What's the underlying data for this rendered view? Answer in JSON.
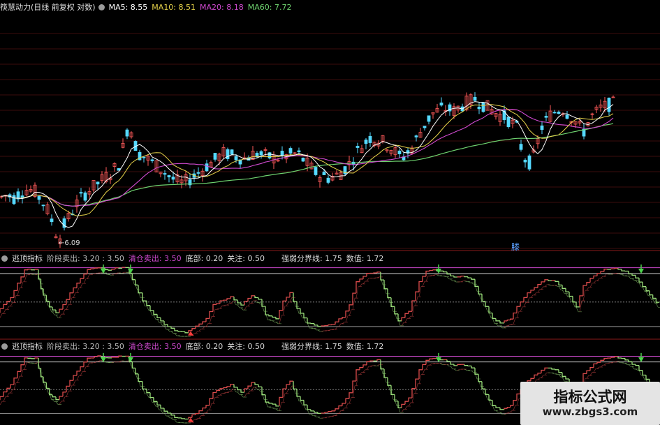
{
  "main_header": {
    "title": "筷慧动力(日线 前复权 对数)",
    "ma5": "MA5: 8.55",
    "ma10": "MA10: 8.51",
    "ma20": "MA20: 8.18",
    "ma60": "MA60: 7.72"
  },
  "ind1_header": {
    "title": "逃顶指标",
    "stage": "阶段卖出: 3.20 : 3.50",
    "clear": "清仓卖出: 3.50",
    "bottom": "底部: 0.20",
    "watch": "关注: 0.50",
    "line": "强弱分界线: 1.75",
    "value": "数值: 1.72"
  },
  "ind2_header": {
    "title": "逃顶指标",
    "stage": "阶段卖出: 3.20 : 3.50",
    "clear": "清仓卖出: 3.50",
    "bottom": "底部: 0.20",
    "watch": "关注: 0.50",
    "line": "强弱分界线: 1.75",
    "value": "数值: 1.72"
  },
  "low_label": "←6.09",
  "signal_mark": "滕",
  "watermark": {
    "title": "指标公式网",
    "url": "www.zbgs3.com"
  },
  "colors": {
    "up": "#ff5a5a",
    "down": "#55d9ff",
    "ma5": "#ffffff",
    "ma10": "#e6d24a",
    "ma20": "#d04ad0",
    "ma60": "#6fd36f",
    "ind_up": "#d94b4b",
    "ind_down": "#9be07a",
    "grid": "#7a1a1a",
    "level": "#c8c8c8"
  },
  "chart_data": [
    {
      "type": "candlestick",
      "title": "",
      "series": [
        {
          "name": "MA5"
        },
        {
          "name": "MA10"
        },
        {
          "name": "MA20"
        },
        {
          "name": "MA60"
        }
      ],
      "price_points": [
        [
          0,
          6.8
        ],
        [
          10,
          6.85
        ],
        [
          20,
          6.8
        ],
        [
          30,
          6.9
        ],
        [
          40,
          6.95
        ],
        [
          50,
          6.9
        ],
        [
          60,
          6.75
        ],
        [
          70,
          6.55
        ],
        [
          78,
          6.3
        ],
        [
          84,
          6.09
        ],
        [
          92,
          6.35
        ],
        [
          100,
          6.5
        ],
        [
          110,
          6.7
        ],
        [
          120,
          6.85
        ],
        [
          130,
          6.95
        ],
        [
          140,
          7.05
        ],
        [
          150,
          7.15
        ],
        [
          160,
          7.25
        ],
        [
          170,
          7.4
        ],
        [
          178,
          7.8
        ],
        [
          185,
          8.25
        ],
        [
          190,
          7.9
        ],
        [
          198,
          7.6
        ],
        [
          210,
          7.5
        ],
        [
          220,
          7.4
        ],
        [
          230,
          7.3
        ],
        [
          240,
          7.2
        ],
        [
          250,
          7.1
        ],
        [
          262,
          7.05
        ],
        [
          275,
          7.15
        ],
        [
          290,
          7.3
        ],
        [
          305,
          7.45
        ],
        [
          320,
          7.6
        ],
        [
          335,
          7.55
        ],
        [
          350,
          7.5
        ],
        [
          365,
          7.6
        ],
        [
          380,
          7.55
        ],
        [
          395,
          7.5
        ],
        [
          410,
          7.55
        ],
        [
          425,
          7.6
        ],
        [
          440,
          7.4
        ],
        [
          455,
          7.2
        ],
        [
          470,
          7.15
        ],
        [
          485,
          7.2
        ],
        [
          500,
          7.4
        ],
        [
          515,
          7.7
        ],
        [
          530,
          7.9
        ],
        [
          545,
          7.85
        ],
        [
          560,
          7.7
        ],
        [
          575,
          7.5
        ],
        [
          590,
          7.7
        ],
        [
          605,
          8.1
        ],
        [
          620,
          8.4
        ],
        [
          635,
          8.5
        ],
        [
          650,
          8.45
        ],
        [
          665,
          8.6
        ],
        [
          680,
          8.7
        ],
        [
          695,
          8.55
        ],
        [
          710,
          8.4
        ],
        [
          725,
          8.3
        ],
        [
          740,
          8.1
        ],
        [
          748,
          7.6
        ],
        [
          756,
          7.4
        ],
        [
          765,
          7.55
        ],
        [
          775,
          8.1
        ],
        [
          790,
          8.4
        ],
        [
          805,
          8.5
        ],
        [
          820,
          8.3
        ],
        [
          835,
          8.0
        ],
        [
          845,
          8.3
        ],
        [
          860,
          8.5
        ],
        [
          875,
          8.6
        ]
      ],
      "low_label": "6.09"
    },
    {
      "type": "step",
      "title": "",
      "levels": {
        "stage_sell": [
          3.2,
          3.5
        ],
        "clear_sell": 3.5,
        "bottom": 0.2,
        "watch": 0.5,
        "line": 1.75
      },
      "ylim": [
        0,
        3.7
      ],
      "x": [
        0,
        20,
        40,
        55,
        62,
        75,
        85,
        95,
        110,
        130,
        145,
        160,
        175,
        185,
        198,
        210,
        225,
        240,
        255,
        270,
        285,
        300,
        310,
        320,
        335,
        350,
        365,
        375,
        385,
        400,
        410,
        420,
        430,
        445,
        460,
        480,
        495,
        505,
        515,
        530,
        545,
        555,
        565,
        575,
        590,
        605,
        615,
        625,
        640,
        655,
        665,
        680,
        695,
        710,
        722,
        735,
        745,
        760,
        770,
        785,
        800,
        815,
        830,
        840,
        855,
        870,
        885,
        900,
        915,
        930,
        944
      ],
      "values": [
        1.2,
        2.0,
        3.4,
        3.4,
        2.4,
        1.5,
        1.2,
        1.6,
        2.5,
        3.4,
        3.5,
        3.4,
        3.5,
        3.5,
        2.6,
        1.8,
        1.1,
        0.6,
        0.3,
        0.2,
        0.5,
        0.9,
        1.6,
        1.8,
        2.0,
        1.6,
        2.1,
        1.9,
        1.1,
        0.9,
        1.8,
        2.2,
        1.4,
        0.7,
        0.5,
        0.6,
        1.0,
        1.6,
        2.8,
        3.2,
        3.3,
        2.4,
        1.5,
        0.8,
        1.3,
        2.8,
        3.3,
        3.4,
        3.3,
        3.0,
        3.1,
        2.9,
        1.8,
        0.9,
        0.7,
        0.9,
        1.5,
        2.2,
        2.5,
        2.9,
        2.8,
        2.3,
        1.5,
        2.6,
        3.1,
        3.4,
        3.5,
        3.3,
        3.0,
        2.3,
        1.72
      ]
    },
    {
      "type": "step",
      "title": "",
      "levels": {
        "stage_sell": [
          3.2,
          3.5
        ],
        "clear_sell": 3.5,
        "bottom": 0.2,
        "watch": 0.5,
        "line": 1.75
      },
      "ylim": [
        0,
        3.7
      ],
      "value": 1.72
    }
  ]
}
